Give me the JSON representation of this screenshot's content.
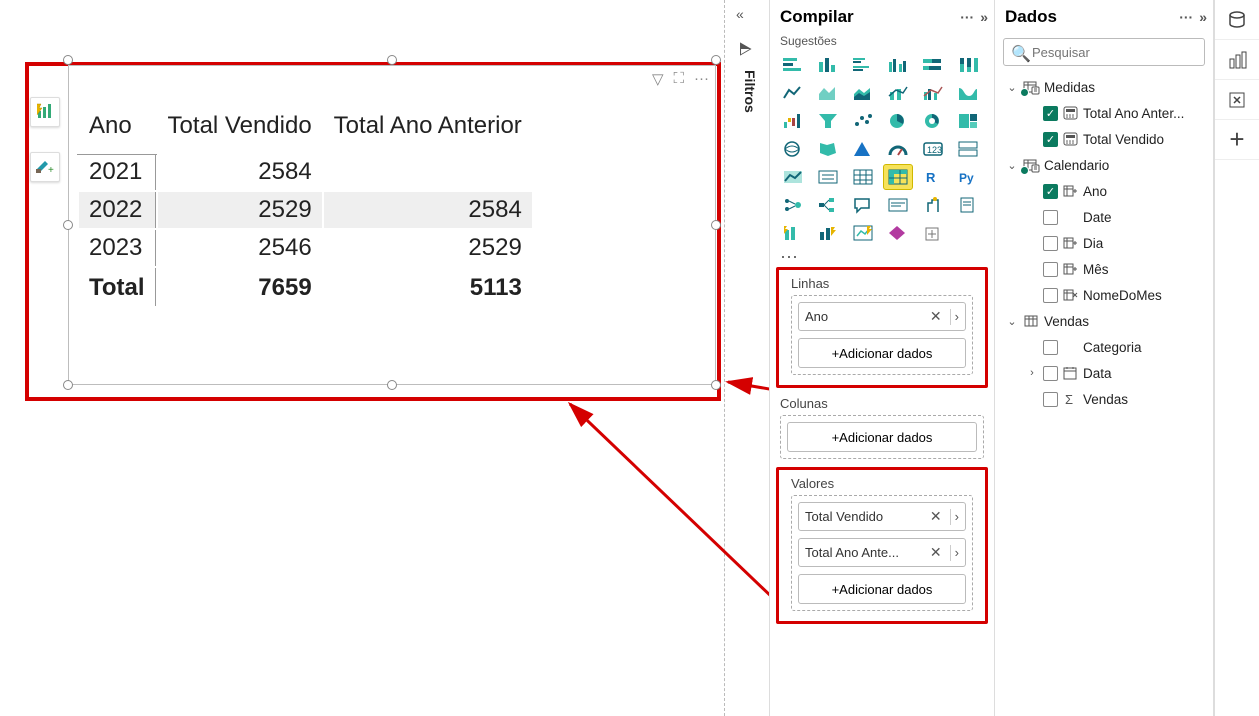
{
  "canvas": {
    "visual_menu": {
      "filter": "▽",
      "focus": "⛶",
      "more": "···"
    }
  },
  "chart_data": {
    "type": "table",
    "columns": [
      "Ano",
      "Total Vendido",
      "Total Ano Anterior"
    ],
    "rows": [
      {
        "Ano": "2021",
        "Total Vendido": 2584,
        "Total Ano Anterior": ""
      },
      {
        "Ano": "2022",
        "Total Vendido": 2529,
        "Total Ano Anterior": 2584
      },
      {
        "Ano": "2023",
        "Total Vendido": 2546,
        "Total Ano Anterior": 2529
      }
    ],
    "totals": {
      "Ano": "Total",
      "Total Vendido": 7659,
      "Total Ano Anterior": 5113
    }
  },
  "filters_strip": {
    "label": "Filtros"
  },
  "compilar": {
    "title": "Compilar",
    "suggestions_label": "Sugestões",
    "more": "···",
    "rows_well": {
      "title": "Linhas",
      "items": [
        "Ano"
      ],
      "add": "+Adicionar dados"
    },
    "cols_well": {
      "title": "Colunas",
      "add": "+Adicionar dados"
    },
    "vals_well": {
      "title": "Valores",
      "items": [
        "Total Vendido",
        "Total Ano Ante..."
      ],
      "add": "+Adicionar dados"
    }
  },
  "dados": {
    "title": "Dados",
    "search_placeholder": "Pesquisar",
    "tables": [
      {
        "name": "Medidas",
        "expanded": true,
        "badge": true,
        "fields": [
          {
            "name": "Total Ano Anter...",
            "checked": true,
            "icon": "calc"
          },
          {
            "name": "Total Vendido",
            "checked": true,
            "icon": "calc"
          }
        ]
      },
      {
        "name": "Calendario",
        "expanded": true,
        "badge": true,
        "fields": [
          {
            "name": "Ano",
            "checked": true,
            "icon": "hier"
          },
          {
            "name": "Date",
            "checked": false,
            "icon": "none"
          },
          {
            "name": "Dia",
            "checked": false,
            "icon": "hier"
          },
          {
            "name": "Mês",
            "checked": false,
            "icon": "hier"
          },
          {
            "name": "NomeDoMes",
            "checked": false,
            "icon": "hierx"
          }
        ]
      },
      {
        "name": "Vendas",
        "expanded": true,
        "badge": false,
        "icon": "table",
        "fields": [
          {
            "name": "Categoria",
            "checked": false,
            "icon": "none"
          },
          {
            "name": "Data",
            "checked": false,
            "icon": "date",
            "expandable": true
          },
          {
            "name": "Vendas",
            "checked": false,
            "icon": "sigma"
          }
        ]
      }
    ]
  }
}
